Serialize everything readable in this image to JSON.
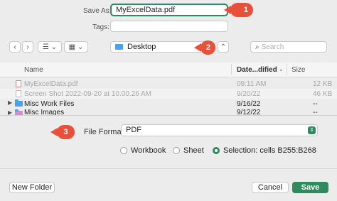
{
  "save_as": {
    "label": "Save As:",
    "value": "MyExcelData.pdf"
  },
  "tags": {
    "label": "Tags:",
    "value": ""
  },
  "toolbar": {
    "back": "‹",
    "forward": "›",
    "list_view": "☰",
    "grid_view": "▦",
    "location": "Desktop",
    "expand": "⌃",
    "search_placeholder": "Search"
  },
  "callouts": [
    "1",
    "2",
    "3"
  ],
  "columns": {
    "name": "Name",
    "date": "Date...dified",
    "size": "Size"
  },
  "files": [
    {
      "name": "MyExcelData.pdf",
      "date": "09:11 AM",
      "size": "12 KB",
      "kind": "pdf",
      "dimmed": true
    },
    {
      "name": "Screen Shot 2022-09-20 at 10.00.26 AM",
      "date": "9/20/22",
      "size": "46 KB",
      "kind": "image",
      "dimmed": true
    },
    {
      "name": "Misc Work Files",
      "date": "9/16/22",
      "size": "--",
      "kind": "folder",
      "dimmed": false
    },
    {
      "name": "Misc Images",
      "date": "9/12/22",
      "size": "--",
      "kind": "folder",
      "dimmed": false
    }
  ],
  "file_format": {
    "label": "File Format:",
    "value": "PDF"
  },
  "scope": {
    "workbook": "Workbook",
    "sheet": "Sheet",
    "selection": "Selection: cells B255:B268",
    "selected": "selection"
  },
  "buttons": {
    "new_folder": "New Folder",
    "cancel": "Cancel",
    "save": "Save"
  },
  "colors": {
    "accent": "#2f8a5d",
    "callout": "#e8503a",
    "folder": "#4aa3e6"
  }
}
